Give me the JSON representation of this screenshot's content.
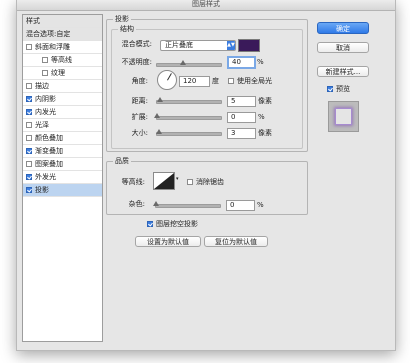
{
  "window": {
    "title": "图层样式"
  },
  "style_list": {
    "header": "样式",
    "blend_options": "混合选项:自定",
    "items": [
      {
        "label": "斜面和浮雕",
        "checked": false,
        "indent": false
      },
      {
        "label": "等高线",
        "checked": false,
        "indent": true
      },
      {
        "label": "纹理",
        "checked": false,
        "indent": true
      },
      {
        "label": "描边",
        "checked": false,
        "indent": false
      },
      {
        "label": "内阴影",
        "checked": true,
        "indent": false
      },
      {
        "label": "内发光",
        "checked": true,
        "indent": false
      },
      {
        "label": "光泽",
        "checked": false,
        "indent": false
      },
      {
        "label": "颜色叠加",
        "checked": false,
        "indent": false
      },
      {
        "label": "渐变叠加",
        "checked": true,
        "indent": false
      },
      {
        "label": "图案叠加",
        "checked": false,
        "indent": false
      },
      {
        "label": "外发光",
        "checked": true,
        "indent": false
      },
      {
        "label": "投影",
        "checked": true,
        "indent": false,
        "selected": true
      }
    ]
  },
  "drop_shadow": {
    "section_title": "投影",
    "structure": {
      "title": "结构",
      "blend_mode_label": "混合模式:",
      "blend_mode_value": "正片叠底",
      "shadow_color": "#3a1a5a",
      "opacity_label": "不透明度:",
      "opacity_value": "40",
      "opacity_unit": "%",
      "opacity_level": 0.4,
      "angle_label": "角度:",
      "angle_value": "120",
      "angle_unit": "度",
      "global_light_label": "使用全局光",
      "global_light_checked": false,
      "distance_label": "距离:",
      "distance_value": "5",
      "distance_unit": "像素",
      "spread_label": "扩展:",
      "spread_value": "0",
      "spread_unit": "%",
      "size_label": "大小:",
      "size_value": "3",
      "size_unit": "像素"
    },
    "quality": {
      "title": "品质",
      "contour_label": "等高线:",
      "anti_alias_label": "消除锯齿",
      "anti_alias_checked": false,
      "noise_label": "杂色:",
      "noise_value": "0",
      "noise_unit": "%"
    },
    "knockout_label": "图层挖空投影",
    "knockout_checked": true,
    "set_default_label": "设置为默认值",
    "reset_default_label": "复位为默认值"
  },
  "buttons": {
    "ok": "确定",
    "cancel": "取消",
    "new_style": "新建样式...",
    "preview_label": "预览",
    "preview_checked": true
  },
  "colors": {
    "accent": "#3b7de0",
    "selection": "#bcd4f0",
    "shadow_color": "#3a1a5a"
  }
}
